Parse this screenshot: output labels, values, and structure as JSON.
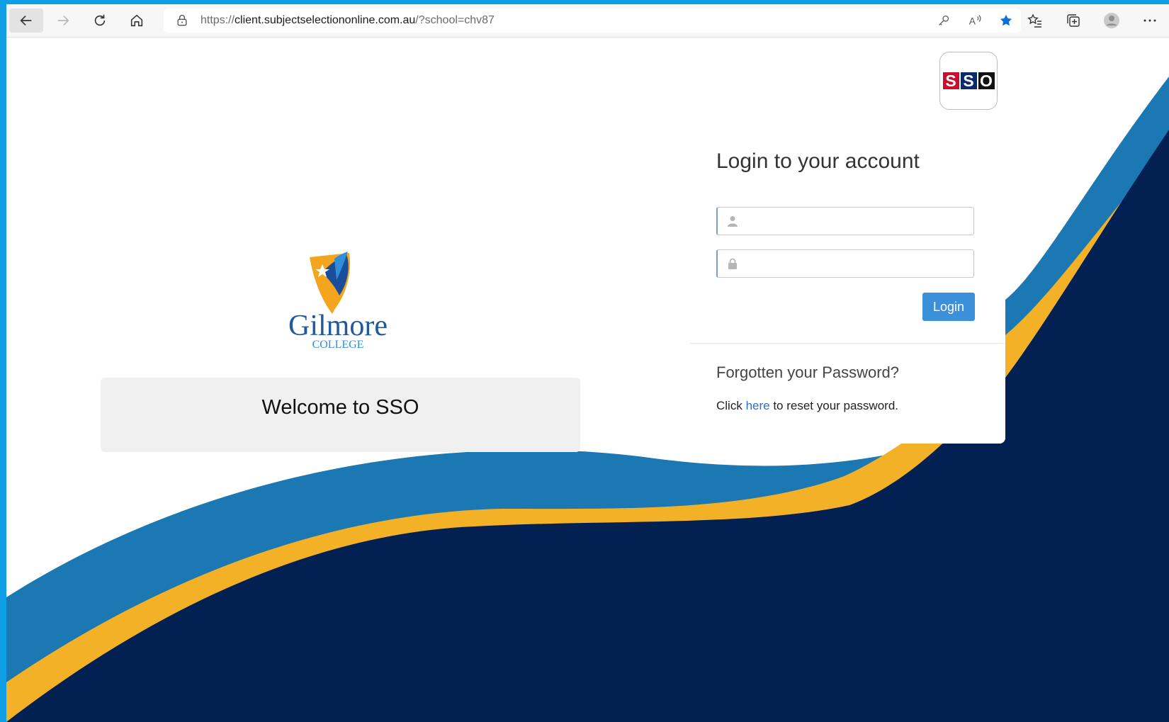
{
  "browser": {
    "url_prefix": "https://",
    "url_host": "client.subjectselectiononline.com.au",
    "url_path": "/?school=chv87"
  },
  "school_logo": {
    "name": "Gilmore",
    "sub": "COLLEGE"
  },
  "welcome": {
    "text": "Welcome to SSO"
  },
  "sso_logo": {
    "letters": [
      "S",
      "S",
      "O"
    ],
    "colors": [
      "#c8102e",
      "#0b2a6b",
      "#111111"
    ]
  },
  "login": {
    "title": "Login to your account",
    "username_value": "",
    "password_value": "",
    "button": "Login"
  },
  "forgot": {
    "title": "Forgotten your Password?",
    "text_before": "Click ",
    "link": "here",
    "text_after": " to reset your password."
  },
  "colors": {
    "navy": "#022051",
    "blue": "#1c78b3",
    "gold": "#f2b126",
    "button": "#3c8fd9",
    "link": "#2a72c4"
  }
}
